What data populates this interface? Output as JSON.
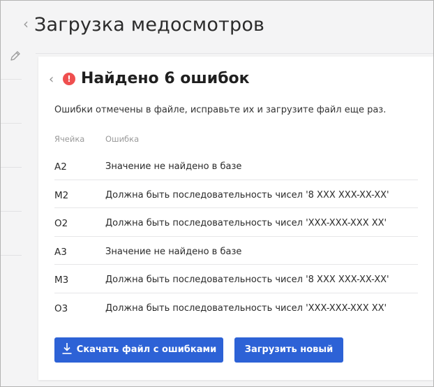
{
  "page": {
    "title": "Загрузка медосмотров"
  },
  "modal": {
    "title": "Найдено 6 ошибок",
    "description": "Ошибки отмечены в файле, исправьте их и загрузите файл еще раз.",
    "columns": {
      "cell": "Ячейка",
      "error": "Ошибка"
    },
    "rows": [
      {
        "cell": "A2",
        "error": "Значение не найдено в базе"
      },
      {
        "cell": "M2",
        "error": "Должна быть последовательность чисел '8 XXX XXX-XX-XX'"
      },
      {
        "cell": "O2",
        "error": "Должна быть последовательность чисел 'XXX-XXX-XXX XX'"
      },
      {
        "cell": "A3",
        "error": "Значение не найдено в базе"
      },
      {
        "cell": "M3",
        "error": "Должна быть последовательность чисел '8 XXX XXX-XX-XX'"
      },
      {
        "cell": "O3",
        "error": "Должна быть последовательность чисел 'XXX-XXX-XXX XX'"
      }
    ],
    "buttons": {
      "download": "Скачать файл с ошибками",
      "upload": "Загрузить новый"
    }
  },
  "colors": {
    "accent": "#2d62d6",
    "error": "#ef4f4f"
  }
}
